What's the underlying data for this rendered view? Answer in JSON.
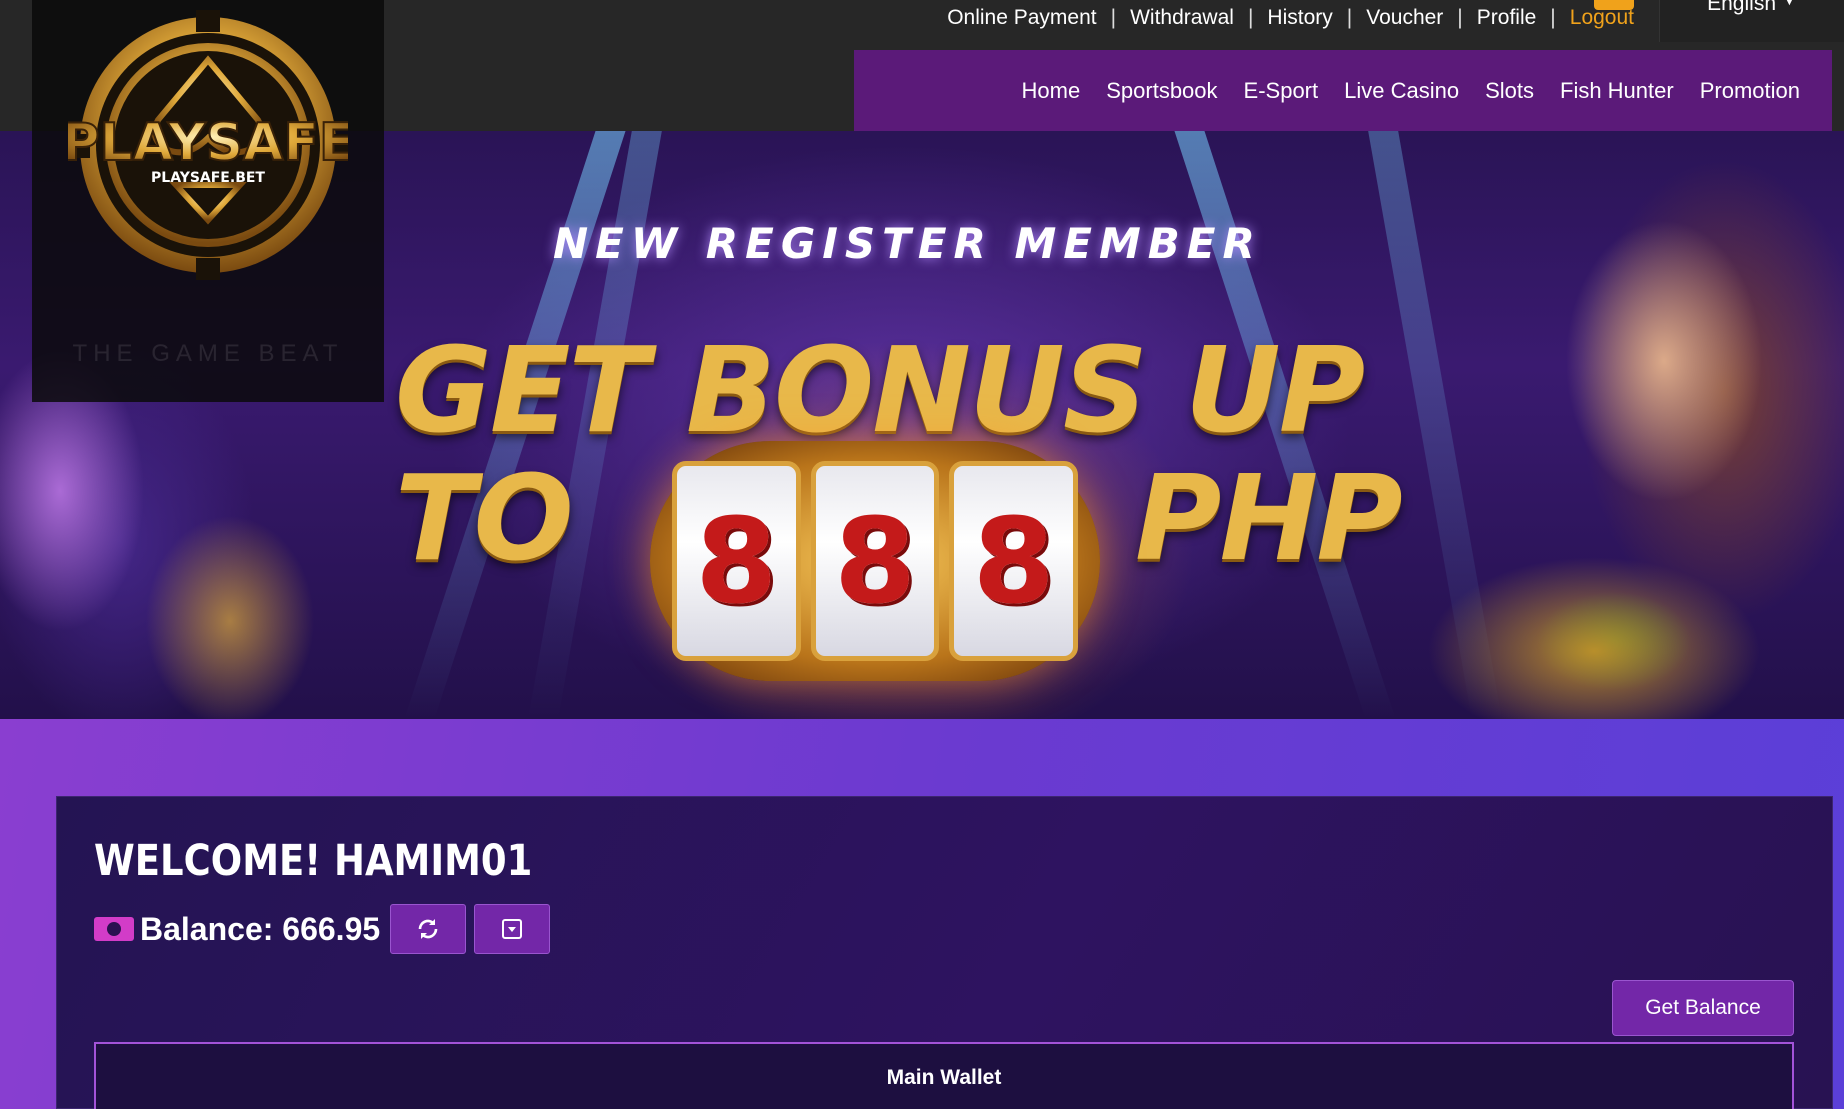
{
  "header": {
    "account_links": [
      {
        "label": "Online Payment"
      },
      {
        "label": "Withdrawal"
      },
      {
        "label": "History"
      },
      {
        "label": "Voucher"
      },
      {
        "label": "Profile"
      },
      {
        "label": "Logout"
      }
    ],
    "language": "English",
    "nav": [
      {
        "label": "Home"
      },
      {
        "label": "Sportsbook"
      },
      {
        "label": "E-Sport"
      },
      {
        "label": "Live Casino"
      },
      {
        "label": "Slots"
      },
      {
        "label": "Fish Hunter"
      },
      {
        "label": "Promotion"
      }
    ]
  },
  "logo": {
    "brand": "PLAYSAFE",
    "domain": "PLAYSAFE.BET",
    "tagline": "THE GAME BEAT"
  },
  "banner": {
    "kicker": "NEW REGISTER MEMBER",
    "line1": "GET BONUS UP",
    "line2_prefix": "TO",
    "line2_suffix": "PHP",
    "reels": [
      "8",
      "8",
      "8"
    ]
  },
  "account": {
    "welcome": "WELCOME! HAMIM01",
    "balance": "Balance: 666.95",
    "get_balance_label": "Get Balance",
    "main_wallet_label": "Main Wallet"
  },
  "icons": {
    "balance": "cash-icon",
    "refresh": "refresh-icon",
    "expand": "expand-icon",
    "language_caret": "caret-down-icon"
  },
  "colors": {
    "accent": "#f0a21b",
    "nav_bg": "#5b1a79",
    "button_bg": "#7327a8",
    "panel_bg": "#241453"
  }
}
